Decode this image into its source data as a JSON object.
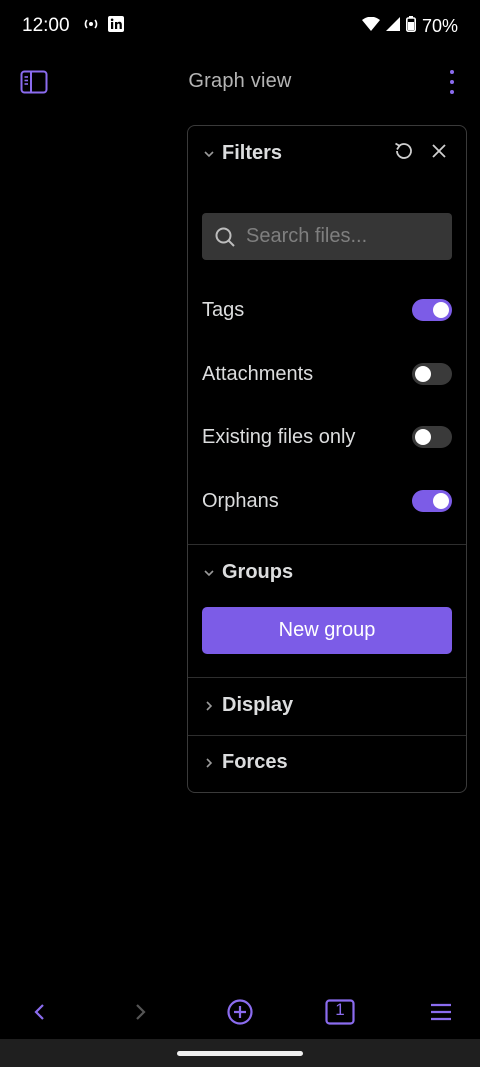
{
  "status_bar": {
    "time": "12:00",
    "battery": "70%",
    "icons": [
      "hotspot-icon",
      "linkedin-icon",
      "wifi-icon",
      "signal-icon",
      "battery-icon"
    ]
  },
  "app_bar": {
    "title": "Graph view",
    "accent": "#8b6cef"
  },
  "panel": {
    "filters": {
      "title": "Filters",
      "search_placeholder": "Search files...",
      "settings": [
        {
          "label": "Tags",
          "enabled": true
        },
        {
          "label": "Attachments",
          "enabled": false
        },
        {
          "label": "Existing files only",
          "enabled": false
        },
        {
          "label": "Orphans",
          "enabled": true
        }
      ]
    },
    "groups": {
      "title": "Groups",
      "new_group_label": "New group"
    },
    "display": {
      "title": "Display"
    },
    "forces": {
      "title": "Forces"
    }
  },
  "bottom_nav": {
    "tab_count": "1"
  },
  "colors": {
    "accent": "#7c5ce7",
    "background": "#000000",
    "toggle_off": "#3a3a3a"
  }
}
